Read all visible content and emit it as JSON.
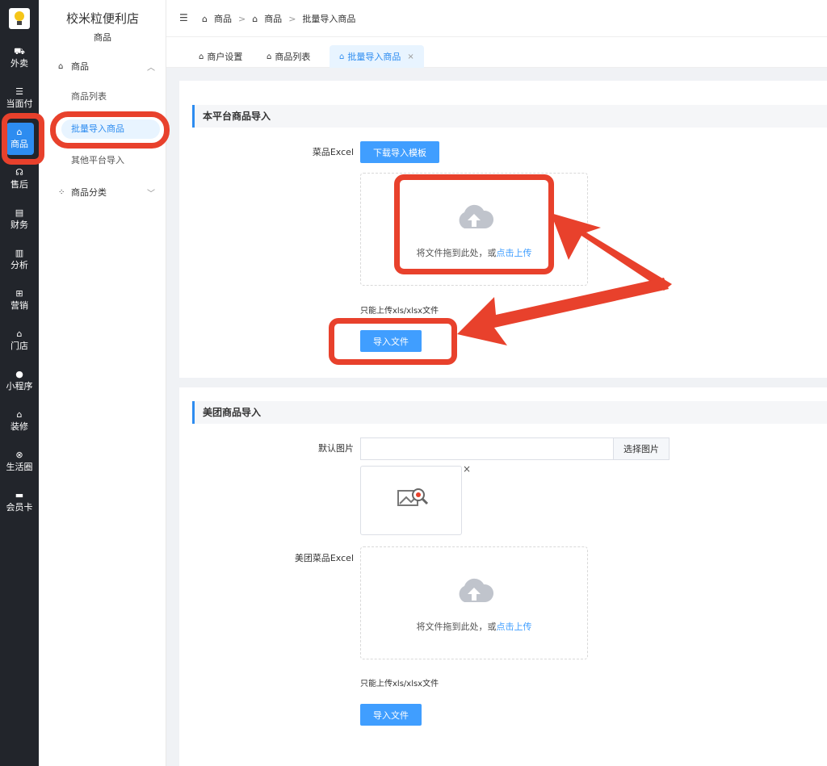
{
  "rail": {
    "logo_icon": "lightbulb-icon",
    "items": [
      {
        "label": "外卖",
        "icon": "⛟"
      },
      {
        "label": "当面付",
        "icon": "☰"
      },
      {
        "label": "商品",
        "icon": "⌂"
      },
      {
        "label": "售后",
        "icon": "☊"
      },
      {
        "label": "财务",
        "icon": "▤"
      },
      {
        "label": "分析",
        "icon": "▥"
      },
      {
        "label": "营销",
        "icon": "⊞"
      },
      {
        "label": "门店",
        "icon": "⌂"
      },
      {
        "label": "小程序",
        "icon": "●"
      },
      {
        "label": "装修",
        "icon": "⌂"
      },
      {
        "label": "生活圈",
        "icon": "⊗"
      },
      {
        "label": "会员卡",
        "icon": "▬"
      }
    ]
  },
  "submenu": {
    "shop_name": "校米粒便利店",
    "section": "商品",
    "group1": "商品",
    "items": [
      "商品列表",
      "批量导入商品",
      "其他平台导入"
    ],
    "group2": "商品分类"
  },
  "header": {
    "fold_icon": "☰",
    "crumbs": [
      "商品",
      "商品",
      "批量导入商品"
    ],
    "sep": ">"
  },
  "tabs": [
    {
      "label": "商户设置"
    },
    {
      "label": "商品列表"
    },
    {
      "label": "批量导入商品",
      "close": "×"
    }
  ],
  "section1": {
    "title": "本平台商品导入",
    "excel_label": "菜品Excel",
    "download_btn": "下载导入模板",
    "drop_text": "将文件拖到此处，或",
    "drop_link": "点击上传",
    "tip": "只能上传xls/xlsx文件",
    "import_btn": "导入文件"
  },
  "section2": {
    "title": "美团商品导入",
    "default_img_label": "默认图片",
    "default_img_value": "",
    "choose_img_btn": "选择图片",
    "close": "×",
    "excel_label": "美团菜品Excel",
    "drop_text": "将文件拖到此处，或",
    "drop_link": "点击上传",
    "tip": "只能上传xls/xlsx文件",
    "import_btn": "导入文件"
  },
  "colors": {
    "accent": "#2d8cf0",
    "button": "#409eff",
    "annotation": "#e8412c",
    "rail_bg": "#22252b"
  }
}
